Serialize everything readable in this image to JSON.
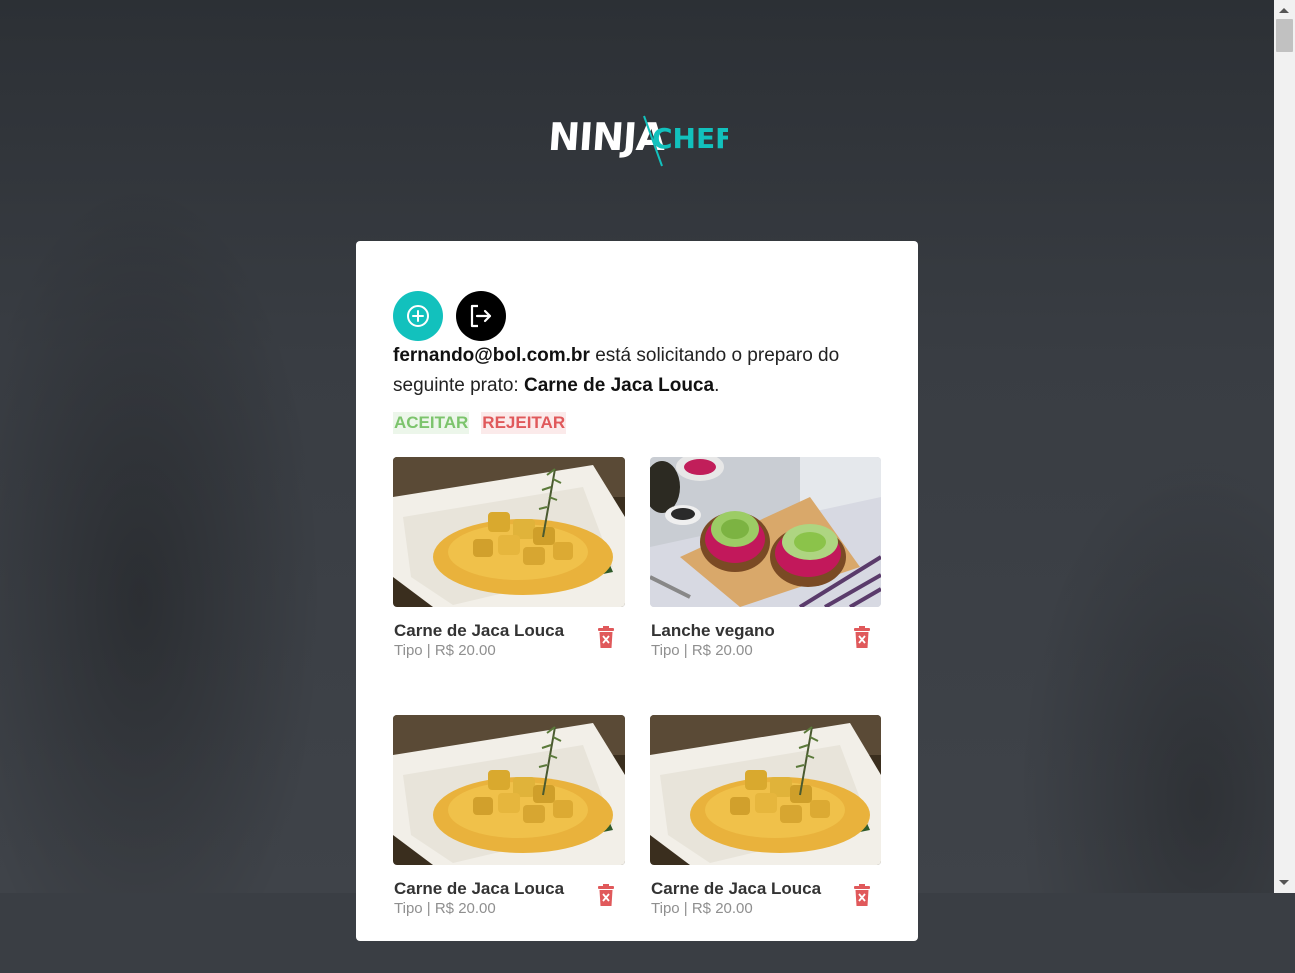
{
  "brand": {
    "logo_text_a": "NINJA",
    "logo_text_b": "CHEF",
    "accent": "#12c1bd"
  },
  "toolbar": {
    "add_icon": "plus-circle-icon",
    "logout_icon": "logout-icon"
  },
  "request": {
    "email": "fernando@bol.com.br",
    "text_middle": " está solicitando o preparo do seguinte prato: ",
    "dish": "Carne de Jaca Louca",
    "text_end": "."
  },
  "actions": {
    "accept": "ACEITAR",
    "reject": "REJEITAR"
  },
  "dishes": [
    {
      "name": "Carne de Jaca Louca",
      "meta": "Tipo | R$ 20.00",
      "image": "jackfruit-stew"
    },
    {
      "name": "Lanche vegano",
      "meta": "Tipo | R$ 20.00",
      "image": "vegan-toast"
    },
    {
      "name": "Carne de Jaca Louca",
      "meta": "Tipo | R$ 20.00",
      "image": "jackfruit-stew"
    },
    {
      "name": "Carne de Jaca Louca",
      "meta": "Tipo | R$ 20.00",
      "image": "jackfruit-stew"
    }
  ],
  "colors": {
    "accept": "#7cc46c",
    "reject": "#e0595b",
    "trash": "#e0595b"
  }
}
